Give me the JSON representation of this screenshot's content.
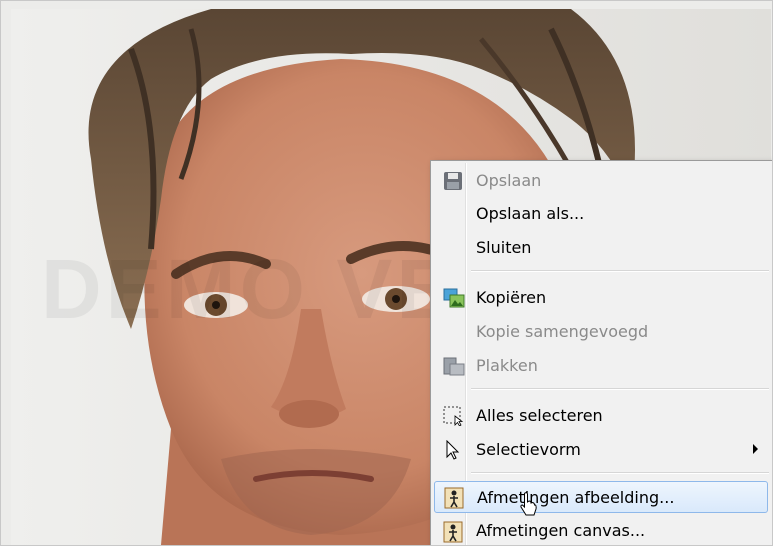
{
  "watermark": "DEMO VERSION",
  "menu": {
    "items": [
      {
        "label": "Opslaan",
        "icon": "floppy-disk-icon",
        "enabled": false
      },
      {
        "label": "Opslaan als...",
        "enabled": true
      },
      {
        "label": "Sluiten",
        "enabled": true
      },
      {
        "label": "Kopiëren",
        "icon": "copy-image-icon",
        "enabled": true
      },
      {
        "label": "Kopie samengevoegd",
        "enabled": false
      },
      {
        "label": "Plakken",
        "icon": "paste-image-icon",
        "enabled": false
      },
      {
        "label": "Alles selecteren",
        "icon": "select-all-icon",
        "enabled": true
      },
      {
        "label": "Selectievorm",
        "icon": "arrow-cursor-icon",
        "enabled": true,
        "submenu": true
      },
      {
        "label": "Afmetingen afbeelding...",
        "icon": "image-size-icon",
        "enabled": true,
        "highlighted": true
      },
      {
        "label": "Afmetingen canvas...",
        "icon": "canvas-size-icon",
        "enabled": true
      }
    ]
  },
  "colors": {
    "highlight_border": "#8eb8ea",
    "highlight_fill": "#d9e9fb",
    "disabled_text": "#8a8a8a"
  }
}
